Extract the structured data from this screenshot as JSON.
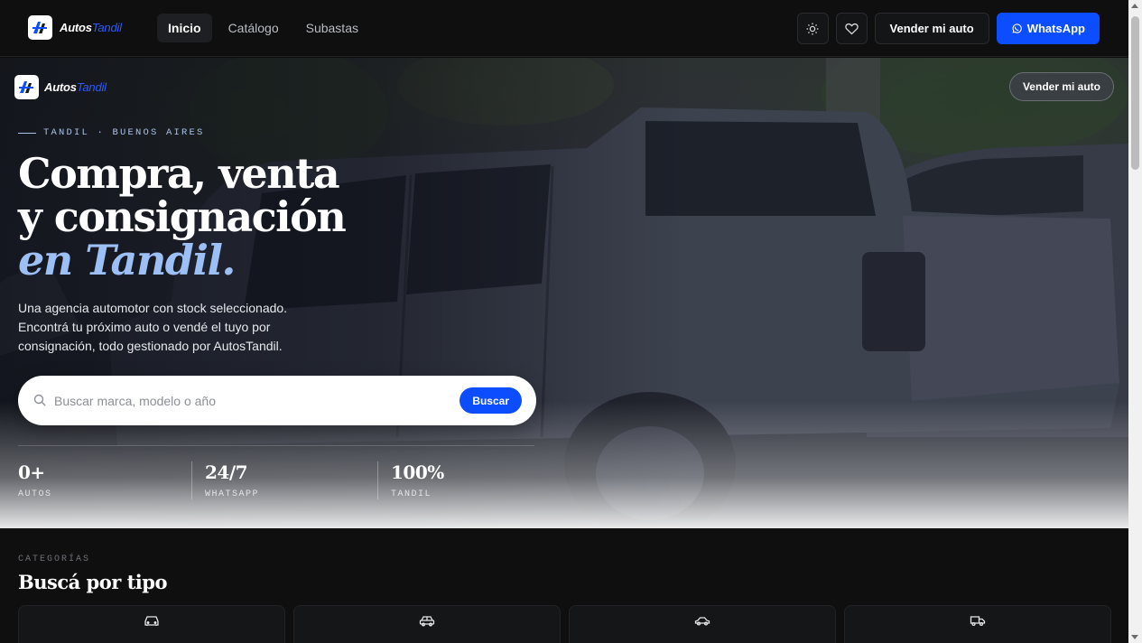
{
  "brand": {
    "name_part1": "Autos",
    "name_part2": "Tandil"
  },
  "nav": {
    "links": [
      {
        "label": "Inicio",
        "active": true
      },
      {
        "label": "Catálogo",
        "active": false
      },
      {
        "label": "Subastas",
        "active": false
      }
    ],
    "theme_icon": "sun-icon",
    "favorites_icon": "heart-icon",
    "sell_label": "Vender mi auto",
    "whatsapp_label": "WhatsApp",
    "whatsapp_icon": "whatsapp-icon"
  },
  "hero": {
    "sell_label": "Vender mi auto",
    "eyebrow": "TANDIL · BUENOS AIRES",
    "headline_line1": "Compra, venta",
    "headline_line2": "y consignación",
    "headline_line3": "en Tandil.",
    "lede": "Una agencia automotor con stock seleccionado. Encontrá tu próximo auto o vendé el tuyo por consignación, todo gestionado por AutosTandil.",
    "search": {
      "placeholder": "Buscar marca, modelo o año",
      "button_label": "Buscar"
    },
    "stats": [
      {
        "value": "0+",
        "label": "AUTOS"
      },
      {
        "value": "24/7",
        "label": "WHATSAPP"
      },
      {
        "value": "100%",
        "label": "TANDIL"
      }
    ]
  },
  "categories": {
    "eyebrow": "CATEGORÍAS",
    "title": "Buscá por tipo",
    "cards": [
      {
        "icon": "car-front-icon"
      },
      {
        "icon": "car-suv-icon"
      },
      {
        "icon": "car-side-icon"
      },
      {
        "icon": "truck-icon"
      }
    ]
  },
  "colors": {
    "accent": "#0b4dff",
    "headline_accent": "#9cc0f5",
    "nav_bg": "#0f0f10"
  }
}
